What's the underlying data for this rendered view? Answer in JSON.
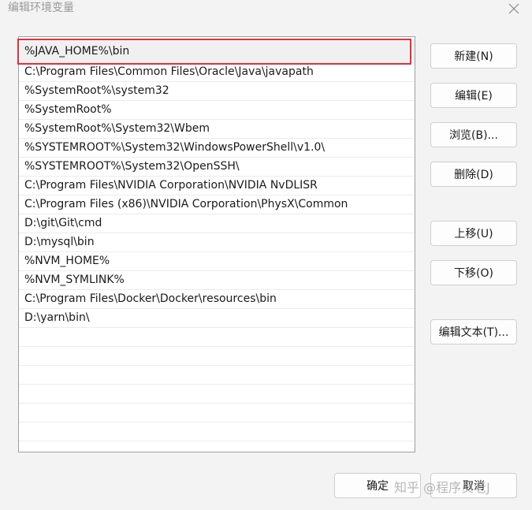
{
  "window": {
    "title": "编辑环境变量"
  },
  "paths": [
    "%JAVA_HOME%\\bin",
    "C:\\Program Files\\Common Files\\Oracle\\Java\\javapath",
    "%SystemRoot%\\system32",
    "%SystemRoot%",
    "%SystemRoot%\\System32\\Wbem",
    "%SYSTEMROOT%\\System32\\WindowsPowerShell\\v1.0\\",
    "%SYSTEMROOT%\\System32\\OpenSSH\\",
    "C:\\Program Files\\NVIDIA Corporation\\NVIDIA NvDLISR",
    "C:\\Program Files (x86)\\NVIDIA Corporation\\PhysX\\Common",
    "D:\\git\\Git\\cmd",
    "D:\\mysql\\bin",
    "%NVM_HOME%",
    "%NVM_SYMLINK%",
    "C:\\Program Files\\Docker\\Docker\\resources\\bin",
    "D:\\yarn\\bin\\"
  ],
  "buttons": {
    "new": "新建(N)",
    "edit": "编辑(E)",
    "browse": "浏览(B)...",
    "delete": "删除(D)",
    "move_up": "上移(U)",
    "move_down": "下移(O)",
    "edit_text": "编辑文本(T)...",
    "ok": "确定",
    "cancel": "取消"
  },
  "watermark": "知乎 @程序员老J"
}
